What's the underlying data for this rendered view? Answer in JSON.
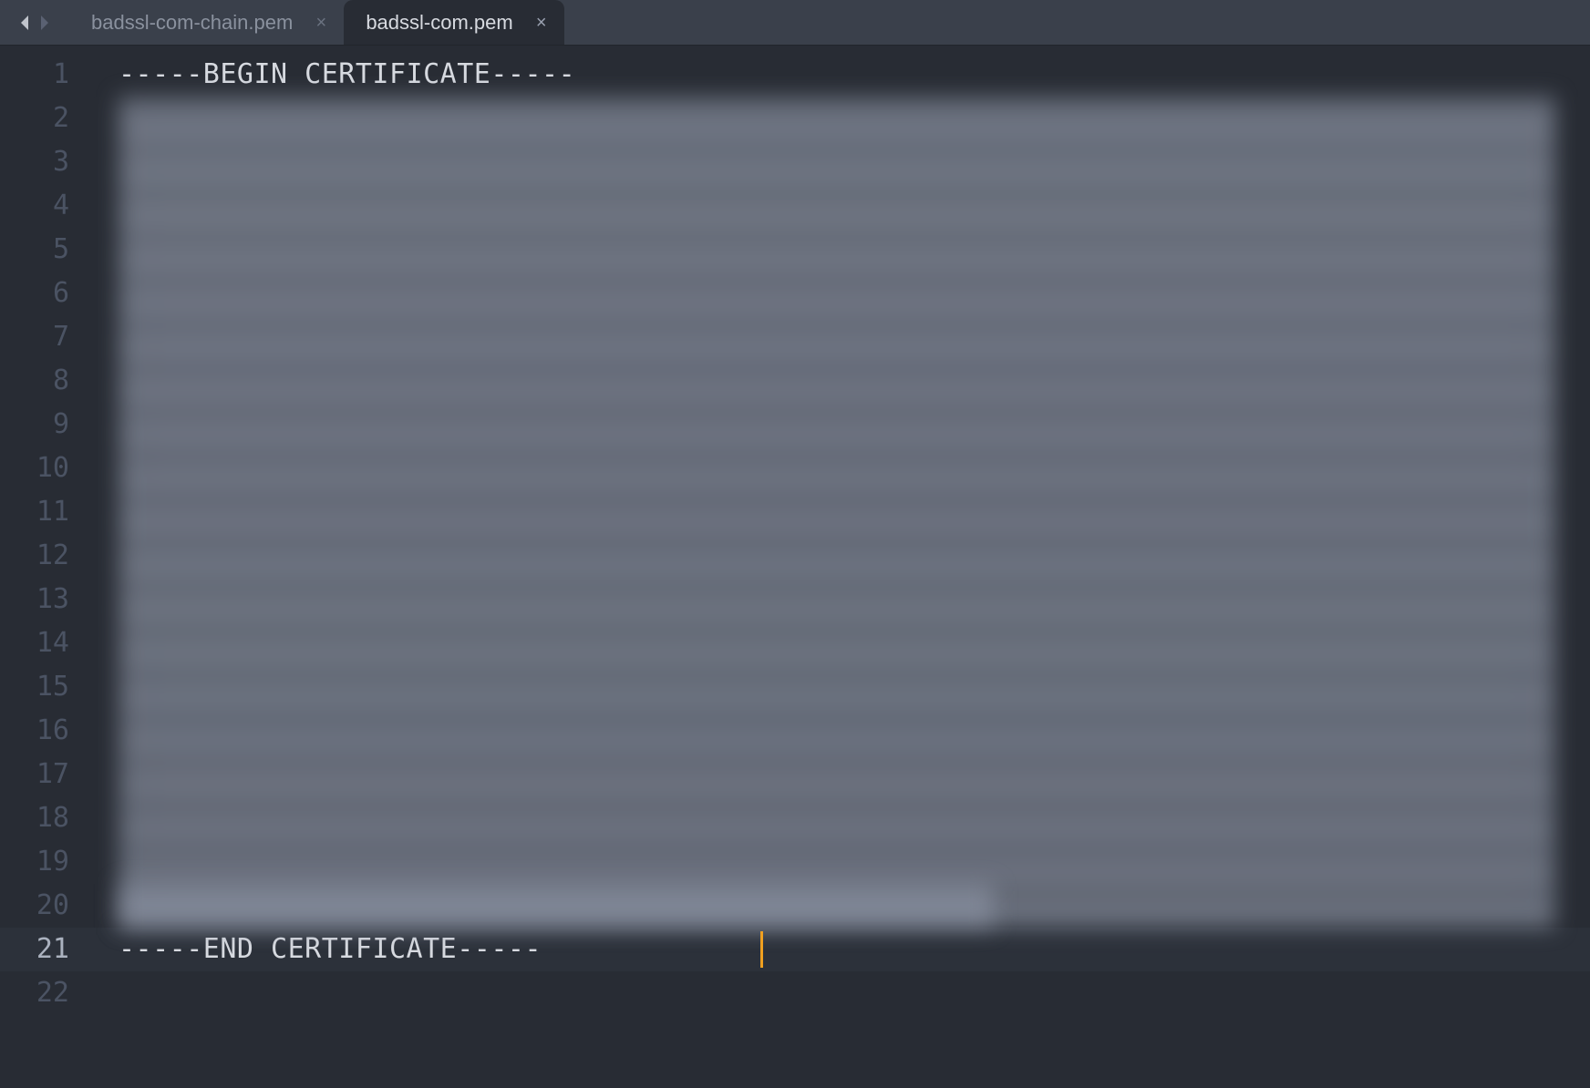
{
  "tabs": [
    {
      "label": "badssl-com-chain.pem",
      "active": false
    },
    {
      "label": "badssl-com.pem",
      "active": true
    }
  ],
  "editor": {
    "line_count": 22,
    "current_line": 21,
    "lines": {
      "1": "-----BEGIN CERTIFICATE-----",
      "21": "-----END CERTIFICATE-----"
    },
    "obscured_range": {
      "start": 2,
      "end": 20
    }
  },
  "icons": {
    "nav_back": "◀",
    "nav_forward": "▶",
    "close": "×"
  },
  "colors": {
    "background": "#282c34",
    "tabbar": "#3a404b",
    "text": "#d7dae0",
    "gutter": "#4b5363",
    "cursor": "#f0a020"
  }
}
